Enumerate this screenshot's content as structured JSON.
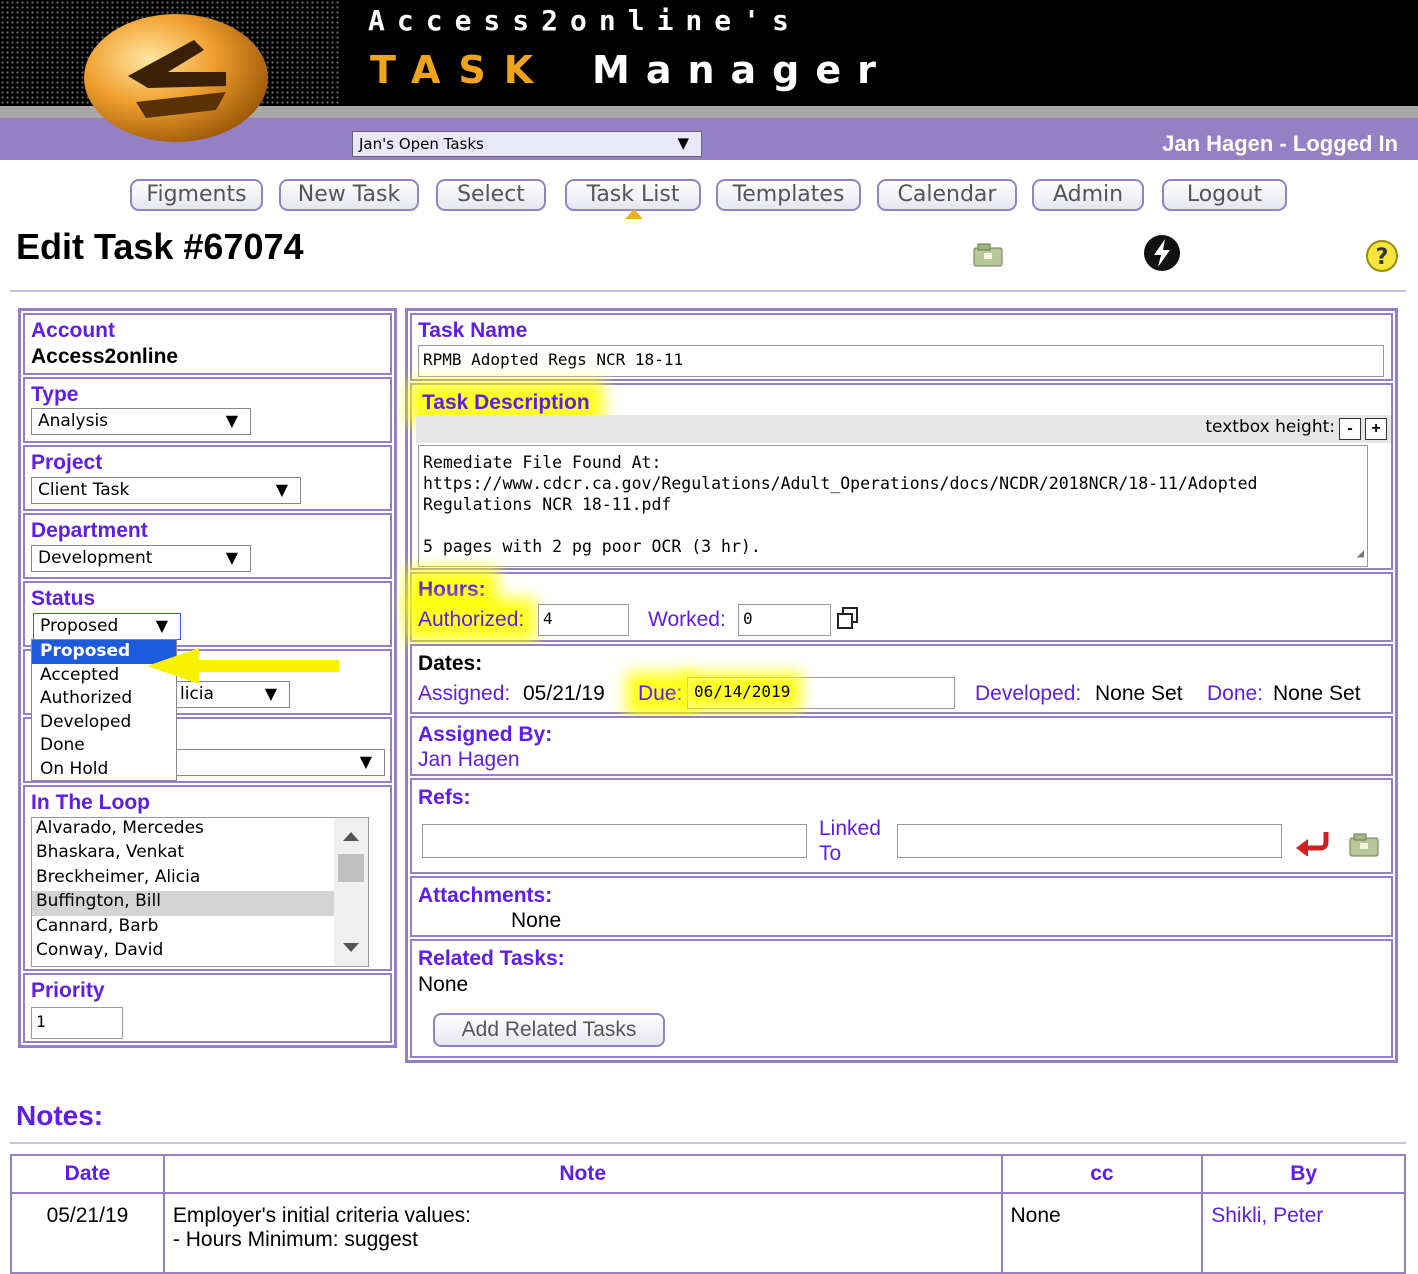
{
  "header": {
    "title_line1": "Access2online's",
    "title_task": "TASK",
    "title_manager": "Manager",
    "task_filter": "Jan's Open Tasks",
    "logged_in": "Jan Hagen - Logged In"
  },
  "nav": [
    "Figments",
    "New Task",
    "Select",
    "Task List",
    "Templates",
    "Calendar",
    "Admin",
    "Logout"
  ],
  "page_title": "Edit Task #67074",
  "left": {
    "account_label": "Account",
    "account_value": "Access2online",
    "type_label": "Type",
    "type_value": "Analysis",
    "project_label": "Project",
    "project_value": "Client Task",
    "department_label": "Department",
    "department_value": "Development",
    "status_label": "Status",
    "status_value": "Proposed",
    "status_options": [
      "Proposed",
      "Accepted",
      "Authorized",
      "Developed",
      "Done",
      "On Hold"
    ],
    "assigned_partial": "licia",
    "loop_label": "In The Loop",
    "loop_items": [
      "Alvarado, Mercedes",
      "Bhaskara, Venkat",
      "Breckheimer, Alicia",
      "Buffington, Bill",
      "Cannard, Barb",
      "Conway, David"
    ],
    "priority_label": "Priority",
    "priority_value": "1"
  },
  "right": {
    "task_name_label": "Task Name",
    "task_name_value": "RPMB Adopted Regs NCR 18-11",
    "desc_label": "Task Description",
    "textbox_height": "textbox height:",
    "minus": "-",
    "plus": "+",
    "desc_line1": "Remediate File Found At:",
    "desc_line2": "https://www.cdcr.ca.gov/Regulations/Adult_Operations/docs/NCDR/2018NCR/18-11/Adopted",
    "desc_line3": "Regulations NCR 18-11.pdf",
    "desc_line4": "5 pages with 2 pg poor OCR (3 hr).",
    "hours_label": "Hours:",
    "authorized_label": "Authorized:",
    "authorized_value": "4",
    "worked_label": "Worked:",
    "worked_value": "0",
    "dates_label": "Dates:",
    "assigned_label": "Assigned:",
    "assigned_value": "05/21/19",
    "due_label": "Due:",
    "due_value": "06/14/2019",
    "developed_label": "Developed:",
    "developed_value": "None Set",
    "done_label": "Done:",
    "done_value": "None Set",
    "assigned_by_label": "Assigned By:",
    "assigned_by_value": "Jan Hagen",
    "refs_label": "Refs:",
    "linked_line1": "Linked",
    "linked_line2": "To",
    "attachments_label": "Attachments:",
    "attachments_value": "None",
    "related_label": "Related Tasks:",
    "related_value": "None",
    "add_related": "Add Related Tasks"
  },
  "notes": {
    "title": "Notes:",
    "headers": [
      "Date",
      "Note",
      "cc",
      "By"
    ],
    "row": {
      "date": "05/21/19",
      "note_line1": "Employer's initial criteria values:",
      "note_line2": "- Hours Minimum: suggest",
      "cc": "None",
      "by": "Shikli, Peter"
    }
  },
  "colors": {
    "accent": "#9480c4",
    "link": "#5f1ee8",
    "highlight": "#ffff00"
  }
}
